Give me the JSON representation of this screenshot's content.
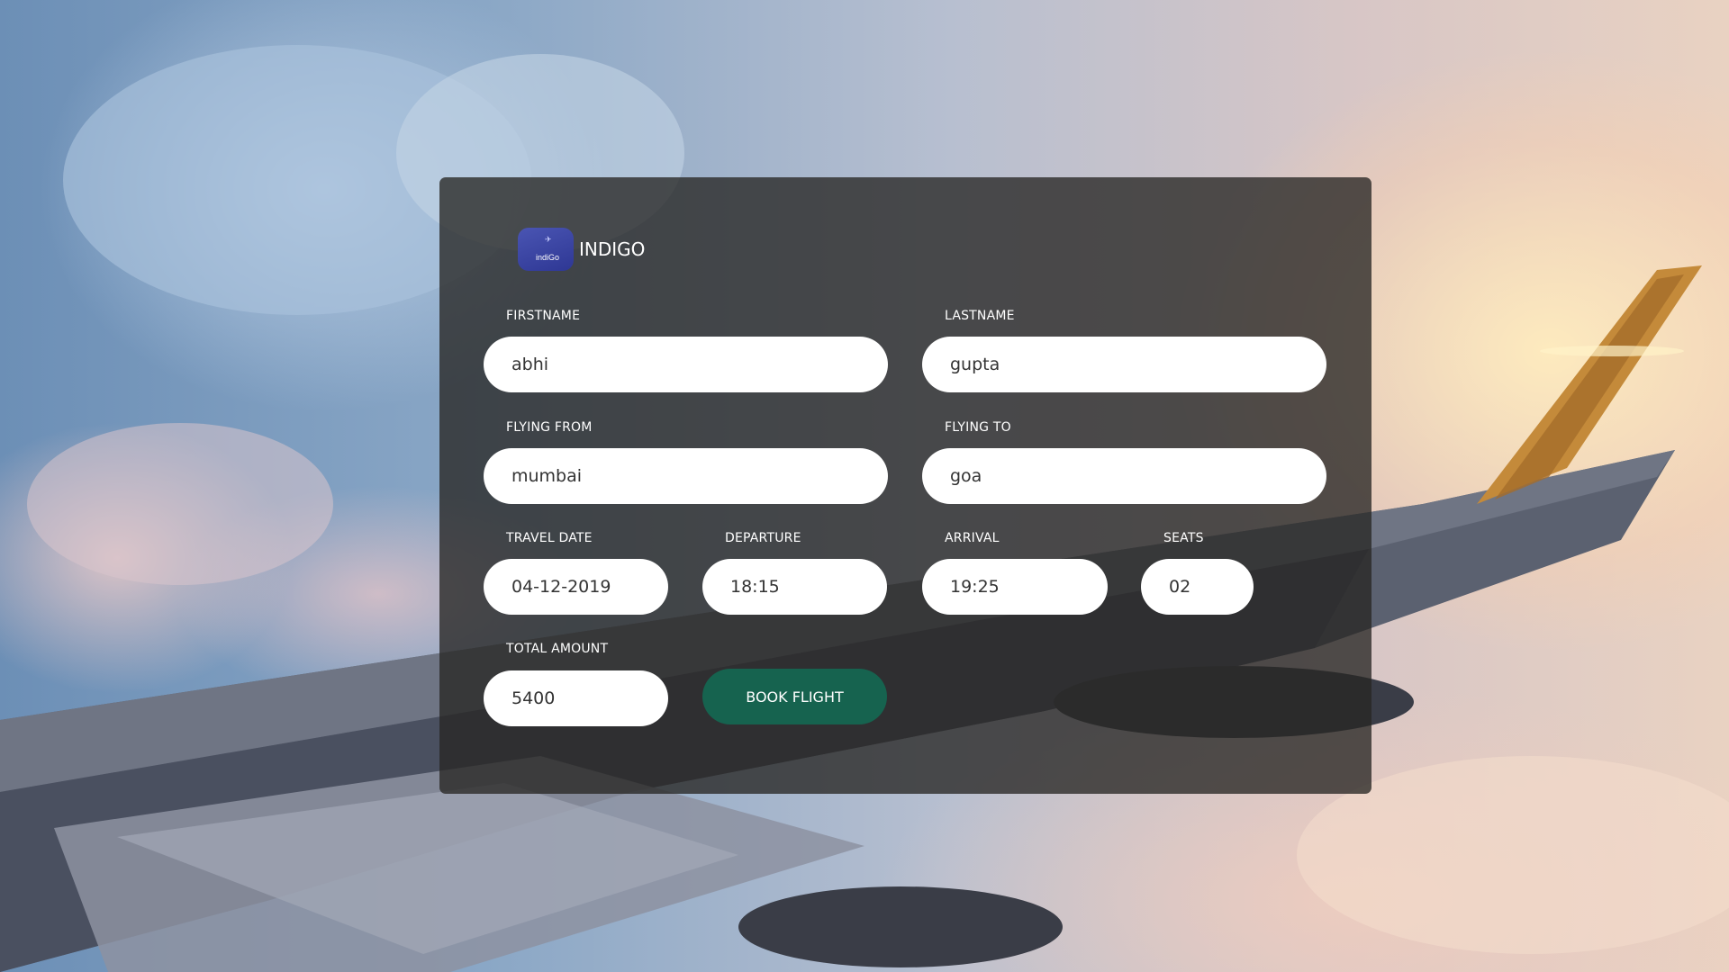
{
  "brand": {
    "logo_text": "indiGo",
    "logo_icon": "plane-icon",
    "name": "INDIGO"
  },
  "form": {
    "firstname": {
      "label": "FIRSTNAME",
      "value": "abhi"
    },
    "lastname": {
      "label": "LASTNAME",
      "value": "gupta"
    },
    "flying_from": {
      "label": "FLYING FROM",
      "value": "mumbai"
    },
    "flying_to": {
      "label": "FLYING TO",
      "value": "goa"
    },
    "travel_date": {
      "label": "TRAVEL DATE",
      "value": "04-12-2019"
    },
    "departure": {
      "label": "DEPARTURE",
      "value": "18:15"
    },
    "arrival": {
      "label": "ARRIVAL",
      "value": "19:25"
    },
    "seats": {
      "label": "SEATS",
      "value": "02"
    },
    "total_amount": {
      "label": "TOTAL AMOUNT",
      "value": "5400"
    },
    "submit_label": "BOOK FLIGHT"
  },
  "colors": {
    "button": "#16634f",
    "logo": "#3a43a6",
    "card": "rgba(40,38,36,0.78)"
  }
}
